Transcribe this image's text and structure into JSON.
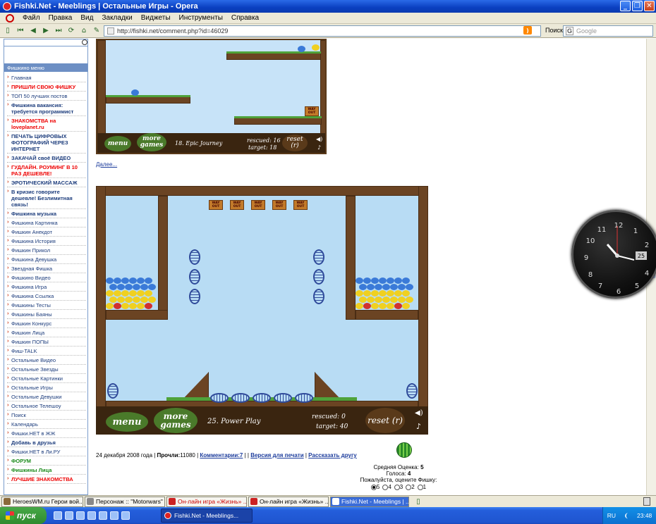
{
  "window": {
    "title": "Fishki.Net - Meeblings | Остальные Игры - Opera"
  },
  "menu": [
    "Файл",
    "Правка",
    "Вид",
    "Закладки",
    "Виджеты",
    "Инструменты",
    "Справка"
  ],
  "address": {
    "url": "http://fishki.net/comment.php?id=46029"
  },
  "search": {
    "label": "Поиск",
    "placeholder": "Google"
  },
  "sidebar": {
    "heading": "Фишкино меню",
    "items": [
      {
        "label": "Главная",
        "style": "normal"
      },
      {
        "label": "ПРИШЛИ СВОЮ ФИШКУ",
        "style": "red"
      },
      {
        "label": "ТОП 50 лучших постов",
        "style": "normal"
      },
      {
        "label": "Фишкина вакансия: требуется программист",
        "style": "bold"
      },
      {
        "label": "ЗНАКОМСТВА на loveplanet.ru",
        "style": "red"
      },
      {
        "label": "ПЕЧАТЬ ЦИФРОВЫХ ФОТОГРАФИЙ ЧЕРЕЗ ИНТЕРНЕТ",
        "style": "bold"
      },
      {
        "label": "ЗАКАЧАЙ своё ВИДЕО",
        "style": "bold"
      },
      {
        "label": "ГУДЛАЙН. РОУМИНГ В 10 РАЗ ДЕШЕВЛЕ!",
        "style": "red"
      },
      {
        "label": "ЭРОТИЧЕСКИЙ МАССАЖ",
        "style": "bold"
      },
      {
        "label": "В кризис говорите дешевле! Безлимитная связь!",
        "style": "bold"
      },
      {
        "label": "Фишкина музыка",
        "style": "bold"
      },
      {
        "label": "Фишкина Картинка",
        "style": "normal"
      },
      {
        "label": "Фишкин Анекдот",
        "style": "normal"
      },
      {
        "label": "Фишкина История",
        "style": "normal"
      },
      {
        "label": "Фишкин Прикол",
        "style": "normal"
      },
      {
        "label": "Фишкина Девушка",
        "style": "normal"
      },
      {
        "label": "Звездная Фишка",
        "style": "normal"
      },
      {
        "label": "Фишкино Видео",
        "style": "normal"
      },
      {
        "label": "Фишкина Игра",
        "style": "normal"
      },
      {
        "label": "Фишкина Ссылка",
        "style": "normal"
      },
      {
        "label": "Фишкины Тесты",
        "style": "normal"
      },
      {
        "label": "Фишкины Баяны",
        "style": "normal"
      },
      {
        "label": "Фишкин Конкурс",
        "style": "normal"
      },
      {
        "label": "Фишкин Лица",
        "style": "normal"
      },
      {
        "label": "Фишкин ПОПЫ",
        "style": "normal"
      },
      {
        "label": "Фиш-TALK",
        "style": "normal"
      },
      {
        "label": "Остальные Видео",
        "style": "normal"
      },
      {
        "label": "Остальные Звезды",
        "style": "normal"
      },
      {
        "label": "Остальные Картинки",
        "style": "normal"
      },
      {
        "label": "Остальные Игры",
        "style": "normal"
      },
      {
        "label": "Остальные Девушки",
        "style": "normal"
      },
      {
        "label": "Остальное Телешоу",
        "style": "normal"
      },
      {
        "label": "Поиск",
        "style": "normal"
      },
      {
        "label": "Календарь",
        "style": "normal"
      },
      {
        "label": "Фишки.НЕТ в ЖЖ",
        "style": "normal"
      },
      {
        "label": "Добавь в друзья",
        "style": "bold"
      },
      {
        "label": "Фишки.НЕТ в Ли.РУ",
        "style": "normal"
      },
      {
        "label": "ФОРУМ",
        "style": "green"
      },
      {
        "label": "Фишкины Лица",
        "style": "green"
      },
      {
        "label": "ЛУЧШИЕ ЗНАКОМСТВА",
        "style": "red"
      }
    ]
  },
  "game1": {
    "level": "18. Epic Journey",
    "menu_label": "menu",
    "more_games_label": "more games",
    "rescued_label": "rescued: 16",
    "target_label": "target: 18",
    "reset_label": "reset (r)",
    "sign": "WAY OUT"
  },
  "more_link": "Далее...",
  "game2": {
    "level": "25. Power Play",
    "menu_label": "menu",
    "more_games_label": "more games",
    "rescued_label": "rescued: 0",
    "target_label": "target: 40",
    "reset_label": "reset (r)",
    "signs": [
      "WAY OUT",
      "WAY OUT",
      "WAY OUT",
      "WAY OUT",
      "WAY OUT"
    ]
  },
  "meta": {
    "date": "24 декабря 2008 года",
    "views_label": "Прочли:",
    "views": "11080",
    "comments": "Комментарии:7",
    "print": "Версия для печати",
    "tell": "Рассказать другу"
  },
  "rating": {
    "avg": "Средняя Оценка:",
    "avg_value": "5",
    "votes": "Голоса:",
    "votes_value": "4",
    "prompt": "Пожалуйста, оцените Фишку:",
    "options": [
      "5",
      "4",
      "3",
      "2",
      "1"
    ],
    "selected": "5"
  },
  "clock": {
    "date": "25"
  },
  "tabs": [
    {
      "label": "HeroesWM.ru Герои вой...",
      "color": "#8a6a3a"
    },
    {
      "label": "Персонаж :: \"Motorwars\"",
      "color": "#888888"
    },
    {
      "label": "Он-лайн игра «Жизнь» ...",
      "color": "#cc2222"
    },
    {
      "label": "Он-лайн игра «Жизнь» ...",
      "color": "#cc2222"
    },
    {
      "label": "Fishki.Net - Meeblings | ...",
      "color": "#ffffff"
    }
  ],
  "taskbar": {
    "start": "пуск",
    "task": "Fishki.Net - Meeblings...",
    "lang": "RU",
    "time": "23:48"
  }
}
